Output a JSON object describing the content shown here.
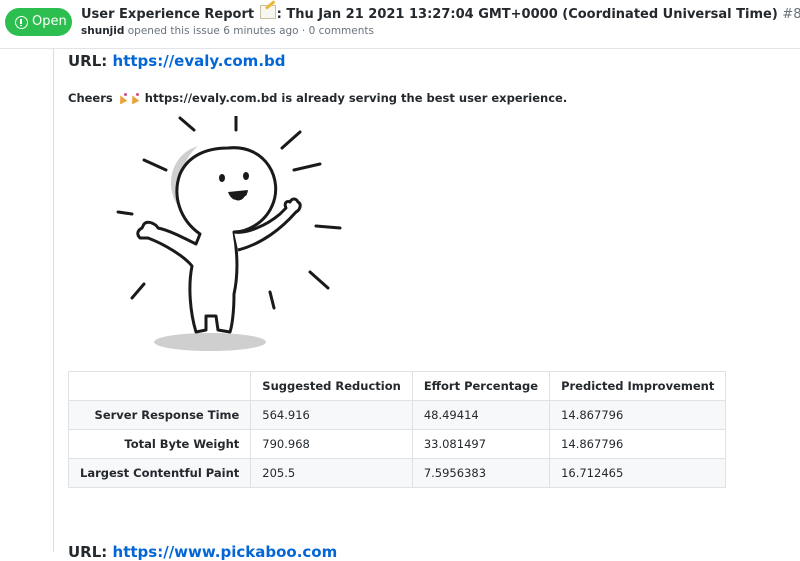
{
  "issue": {
    "state_label": "Open",
    "title_prefix": "User Experience Report",
    "title_suffix": ": Thu Jan 21 2021 13:27:04 GMT+0000 (Coordinated Universal Time)",
    "number": "#8",
    "author": "shunjid",
    "meta_text": "opened this issue 6 minutes ago · 0 comments"
  },
  "body": {
    "url_label": "URL:",
    "url": "https://evaly.com.bd",
    "cheers_word": "Cheers",
    "cheers_text": "https://evaly.com.bd is already serving the best user experience.",
    "table": {
      "headers": [
        "",
        "Suggested Reduction",
        "Effort Percentage",
        "Predicted Improvement"
      ],
      "rows": [
        {
          "metric": "Server Response Time",
          "reduction": "564.916",
          "effort": "48.49414",
          "improvement": "14.867796"
        },
        {
          "metric": "Total Byte Weight",
          "reduction": "790.968",
          "effort": "33.081497",
          "improvement": "14.867796"
        },
        {
          "metric": "Largest Contentful Paint",
          "reduction": "205.5",
          "effort": "7.5956383",
          "improvement": "16.712465"
        }
      ]
    },
    "next_url_label": "URL:",
    "next_url": "https://www.pickaboo.com"
  },
  "icons": {
    "state": "issue-opened-icon",
    "title_emoji": "memo-icon",
    "cheers_emoji": "party-popper-icon",
    "illustration": "cheering-character-illustration"
  },
  "colors": {
    "open_green": "#2cbe4e",
    "link_blue": "#0366d6"
  }
}
